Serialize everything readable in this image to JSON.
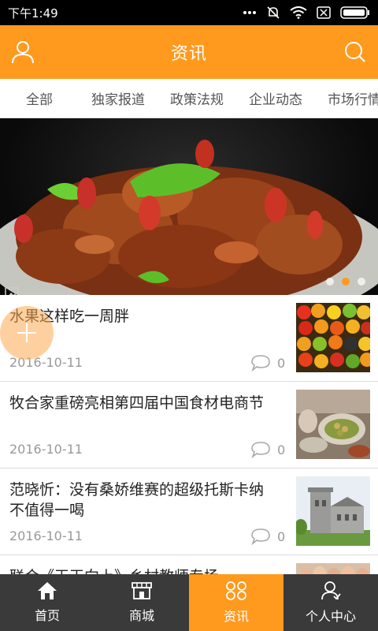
{
  "status_bar": {
    "time": "下午1:49"
  },
  "header": {
    "title": "资讯"
  },
  "tabs": [
    "全部",
    "独家报道",
    "政策法规",
    "企业动态",
    "市场行情"
  ],
  "banner": {
    "slide_count": 3,
    "active_slide": 2
  },
  "news": [
    {
      "title": "水果这样吃一周胖",
      "date": "2016-10-11",
      "comments": "0"
    },
    {
      "title": "牧合家重磅亮相第四届中国食材电商节",
      "date": "2016-10-11",
      "comments": "0"
    },
    {
      "title": "范晓忻：没有桑娇维赛的超级托斯卡纳 不值得一喝",
      "date": "2016-10-11",
      "comments": "0"
    },
    {
      "title": "联合《天天向上》乡村教师专场"
    }
  ],
  "bottom_nav": [
    {
      "label": "首页",
      "icon": "home-icon"
    },
    {
      "label": "商城",
      "icon": "shop-icon"
    },
    {
      "label": "资讯",
      "icon": "grid-icon",
      "active": true
    },
    {
      "label": "个人中心",
      "icon": "user-icon"
    }
  ],
  "colors": {
    "accent": "#ff9a1e",
    "nav_bg": "#3a3a3a"
  }
}
